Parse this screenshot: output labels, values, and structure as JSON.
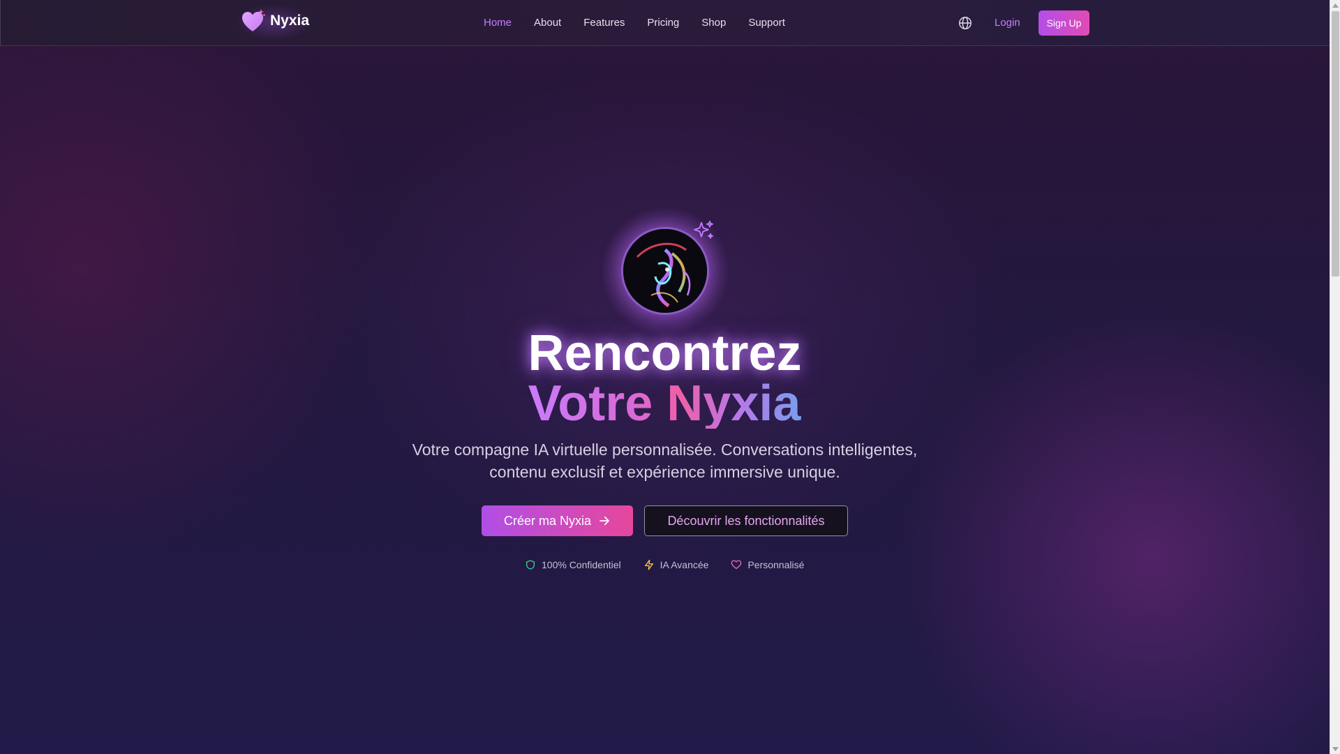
{
  "brand": {
    "name": "Nyxia",
    "logo_icon": "heart-sparkle-icon"
  },
  "nav": {
    "links": [
      {
        "label": "Home",
        "active": true
      },
      {
        "label": "About",
        "active": false
      },
      {
        "label": "Features",
        "active": false
      },
      {
        "label": "Pricing",
        "active": false
      },
      {
        "label": "Shop",
        "active": false
      },
      {
        "label": "Support",
        "active": false
      }
    ],
    "language_icon": "globe-icon",
    "login_label": "Login",
    "signup_label": "Sign Up"
  },
  "hero": {
    "avatar_alt": "abstract iridescent avatar",
    "title_line1": "Rencontrez",
    "title_line2": "Votre Nyxia",
    "subtitle": "Votre compagne IA virtuelle personnalisée. Conversations intelligentes, contenu exclusif et expérience immersive unique.",
    "primary_cta": "Créer ma Nyxia",
    "secondary_cta": "Découvrir les fonctionnalités",
    "features": [
      {
        "label": "100% Confidentiel",
        "icon": "shield-icon",
        "color": "#3ecf8e"
      },
      {
        "label": "IA Avancée",
        "icon": "lightning-icon",
        "color": "#f5c542"
      },
      {
        "label": "Personnalisé",
        "icon": "heart-icon",
        "color": "#f06ab6"
      }
    ]
  },
  "colors": {
    "accent": "#c77dff",
    "cta_gradient_start": "#b04fe6",
    "cta_gradient_end": "#e6479c",
    "background": "#23183f"
  }
}
